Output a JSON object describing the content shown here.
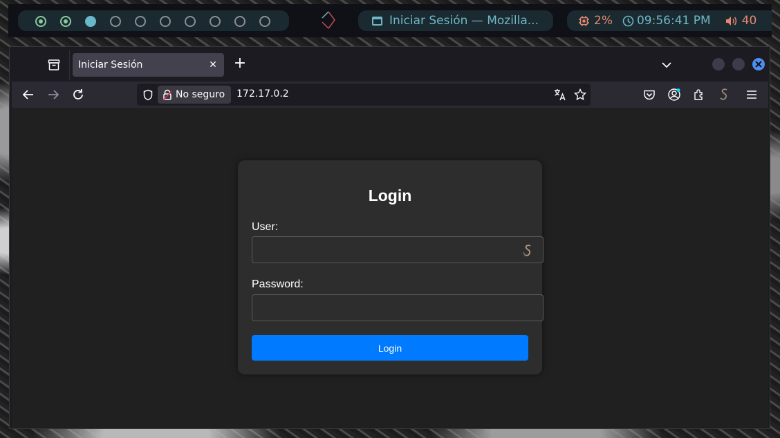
{
  "topbar": {
    "workspaces": [
      {
        "state": "occupied"
      },
      {
        "state": "occupied"
      },
      {
        "state": "current"
      },
      {
        "state": "empty"
      },
      {
        "state": "empty"
      },
      {
        "state": "empty"
      },
      {
        "state": "empty"
      },
      {
        "state": "empty"
      },
      {
        "state": "empty"
      },
      {
        "state": "empty"
      }
    ],
    "window_title": "Iniciar Sesión — Mozilla...",
    "cpu": "2%",
    "clock": "09:56:41 PM",
    "volume": "40",
    "colors": {
      "accent": "#6fb7c8",
      "warm": "#e6876f",
      "workspace_active": "#8cc9a0"
    }
  },
  "browser": {
    "tab": {
      "title": "Iniciar Sesión",
      "close_glyph": "✕"
    },
    "new_tab_glyph": "+",
    "security_label": "No seguro",
    "url": "172.17.0.2"
  },
  "login": {
    "heading": "Login",
    "user_label": "User:",
    "user_value": "",
    "password_label": "Password:",
    "password_value": "",
    "submit_label": "Login",
    "button_color": "#007bff"
  }
}
